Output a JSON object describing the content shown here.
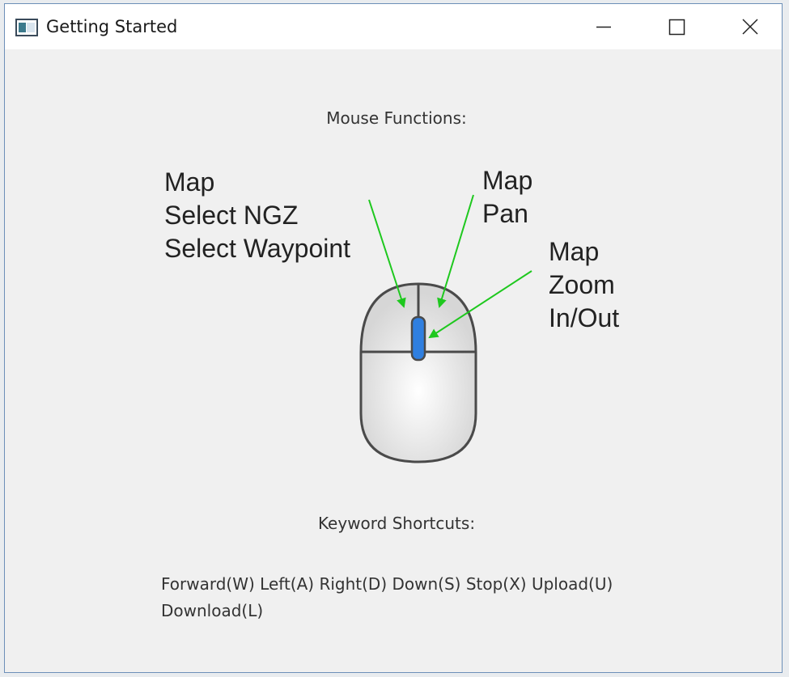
{
  "window": {
    "title": "Getting Started",
    "icons": {
      "app": "app-window-icon",
      "minimize": "minimize-icon",
      "maximize": "maximize-icon",
      "close": "close-icon"
    }
  },
  "mouse_section": {
    "heading": "Mouse Functions:",
    "left_button_lines": [
      "Map",
      "Select NGZ",
      "Select Waypoint"
    ],
    "right_button_lines": [
      "Map",
      "Pan"
    ],
    "scroll_wheel_lines": [
      "Map",
      "Zoom",
      "In/Out"
    ],
    "colors": {
      "arrow": "#1ec81e",
      "wheel": "#2f7fe0",
      "mouse_outline": "#4a4a4a"
    }
  },
  "keyboard_section": {
    "heading": "Keyword Shortcuts:",
    "shortcuts": [
      "Forward(W)",
      "Left(A)",
      "Right(D)",
      "Down(S)",
      "Stop(X)",
      "Upload(U)",
      "Download(L)"
    ]
  }
}
